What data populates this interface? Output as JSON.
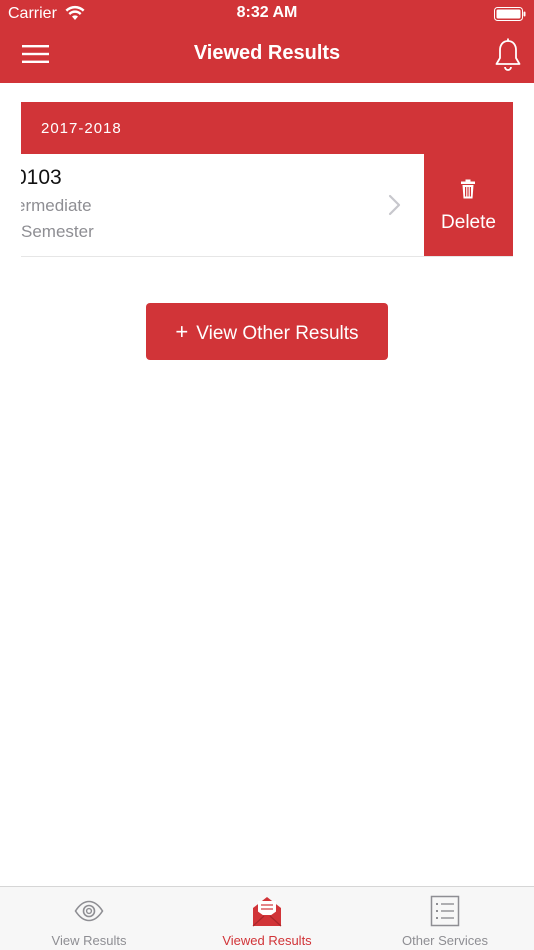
{
  "status_bar": {
    "carrier": "Carrier",
    "time": "8:32 AM",
    "wifi_icon": "wifi-icon",
    "battery_icon": "battery-icon"
  },
  "header": {
    "title": "Viewed Results",
    "menu_icon": "hamburger-menu-icon",
    "bell_icon": "bell-icon"
  },
  "section": {
    "year": "2017-2018"
  },
  "result_item": {
    "code": "0103",
    "level": "ermediate",
    "semester": "Semester",
    "chevron_icon": "chevron-right-icon"
  },
  "delete_action": {
    "label": "Delete",
    "icon": "trash-icon"
  },
  "view_other": {
    "plus": "+",
    "label": "View Other Results"
  },
  "tabs": [
    {
      "label": "View Results",
      "icon": "eye-icon",
      "active": false
    },
    {
      "label": "Viewed Results",
      "icon": "open-envelope-icon",
      "active": true
    },
    {
      "label": "Other Services",
      "icon": "list-icon",
      "active": false
    }
  ],
  "colors": {
    "accent": "#d13438",
    "inactive_tab": "#8e8e93",
    "secondary_text": "#8e8e93",
    "tabbar_bg": "#f7f7f7"
  }
}
